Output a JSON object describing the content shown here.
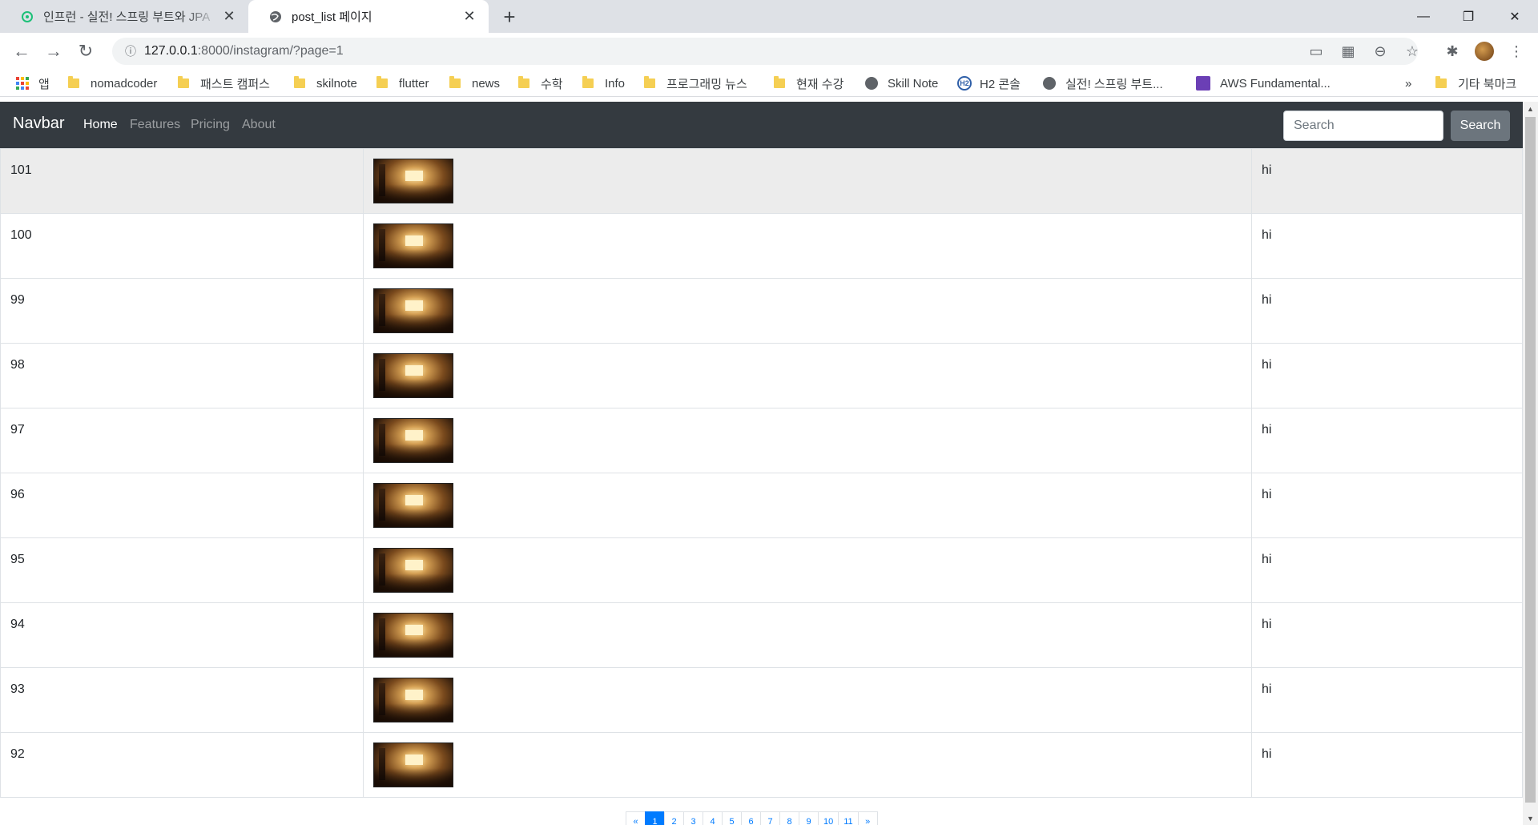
{
  "browser": {
    "tabs": [
      {
        "title": "인프런 - 실전! 스프링 부트와 JPA",
        "active": false
      },
      {
        "title": "post_list 페이지",
        "active": true
      }
    ],
    "new_tab_label": "+",
    "window_controls": {
      "minimize": "—",
      "restore": "❐",
      "close": "✕"
    },
    "url_host": "127.0.0.1",
    "url_rest": ":8000/instagram/?page=1",
    "bookmarks": [
      {
        "icon": "apps-icon",
        "label": "앱"
      },
      {
        "icon": "folder-icon",
        "label": "nomadcoder"
      },
      {
        "icon": "folder-icon",
        "label": "패스트 캠퍼스"
      },
      {
        "icon": "folder-icon",
        "label": "skilnote"
      },
      {
        "icon": "folder-icon",
        "label": "flutter"
      },
      {
        "icon": "folder-icon",
        "label": "news"
      },
      {
        "icon": "folder-icon",
        "label": "수학"
      },
      {
        "icon": "folder-icon",
        "label": "Info"
      },
      {
        "icon": "folder-icon",
        "label": "프로그래밍 뉴스"
      },
      {
        "icon": "folder-icon",
        "label": "현재 수강"
      },
      {
        "icon": "globe-icon",
        "label": "Skill Note"
      },
      {
        "icon": "h2-icon",
        "label": "H2 콘솔"
      },
      {
        "icon": "globe-icon",
        "label": "실전! 스프링 부트..."
      },
      {
        "icon": "aws-icon",
        "label": "AWS Fundamental..."
      }
    ],
    "bookmarks_overflow": "»",
    "other_bookmarks": "기타 북마크"
  },
  "navbar": {
    "brand": "Navbar",
    "links": [
      "Home",
      "Features",
      "Pricing",
      "About"
    ],
    "active_link": "Home",
    "search_placeholder": "Search",
    "search_button": "Search"
  },
  "posts": [
    {
      "id": "101",
      "message": "hi"
    },
    {
      "id": "100",
      "message": "hi"
    },
    {
      "id": "99",
      "message": "hi"
    },
    {
      "id": "98",
      "message": "hi"
    },
    {
      "id": "97",
      "message": "hi"
    },
    {
      "id": "96",
      "message": "hi"
    },
    {
      "id": "95",
      "message": "hi"
    },
    {
      "id": "94",
      "message": "hi"
    },
    {
      "id": "93",
      "message": "hi"
    },
    {
      "id": "92",
      "message": "hi"
    }
  ],
  "pagination": {
    "prev": "«",
    "pages": [
      "1",
      "2",
      "3",
      "4",
      "5",
      "6",
      "7",
      "8",
      "9",
      "10",
      "11"
    ],
    "current": "1",
    "next": "»"
  },
  "colors": {
    "navbar_bg": "#343a40",
    "primary": "#007bff",
    "search_button_bg": "#6c757d",
    "first_row_bg": "#ececec"
  }
}
